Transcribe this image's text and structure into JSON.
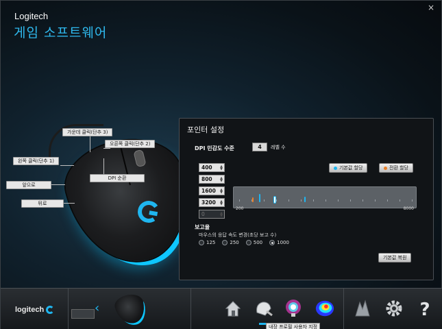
{
  "window": {
    "close_label": "×"
  },
  "header": {
    "brand": "Logitech",
    "title": "게임 소프트웨어"
  },
  "callouts": {
    "middle_click": "가운데 클릭(단추 3)",
    "right_click": "오른쪽 클릭(단추 2)",
    "left_click": "왼쪽 클릭(단추 1)",
    "dpi_cycle": "DPI 순환",
    "forward": "앞으로",
    "back": "뒤로"
  },
  "panel": {
    "title": "포인터 설정",
    "dpi_label": "DPI 민감도 수준",
    "level_count": "4",
    "level_label": "레벨 수",
    "btn_default_dpi": "기본값 할당",
    "btn_shift_dpi": "전환 할당",
    "dpi_levels": [
      "400",
      "800",
      "1600",
      "3200",
      "0"
    ],
    "slider": {
      "min_label": "200",
      "max_label": "8000"
    },
    "rate_label": "보고율",
    "rate_sub": "마우스의 응답 속도 변경(초당 보고 수)",
    "rates": [
      "125",
      "250",
      "500",
      "1000"
    ],
    "selected_rate": "1000",
    "restore_button": "기본값 복원"
  },
  "bottom_bar": {
    "logo_text": "logitech",
    "tooltip": "내장 프로필 사용자 지정"
  },
  "colors": {
    "accent": "#1fb6f0",
    "default_marker": "#1fb6f0",
    "shift_marker": "#e8802a"
  }
}
